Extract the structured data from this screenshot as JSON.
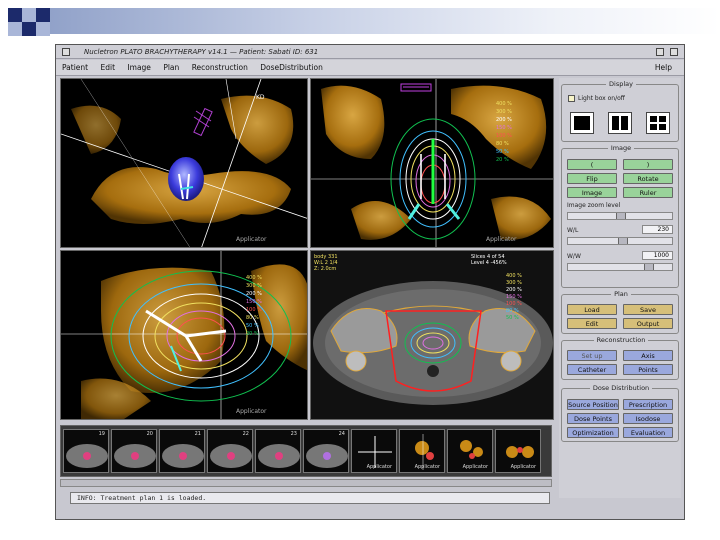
{
  "window": {
    "title": "Nucletron PLATO BRACHYTHERAPY v14.1 — Patient: Sabati  ID: 631",
    "menu": [
      "Patient",
      "Edit",
      "Image",
      "Plan",
      "Reconstruction",
      "DoseDistribution"
    ],
    "help": "Help"
  },
  "views": {
    "top_left": {
      "label": "Applicator",
      "corner": "KD"
    },
    "top_right": {
      "label": "Applicator",
      "isodose_labels": [
        "400 %",
        "300 %",
        "200 %",
        "150 %",
        "100 %",
        "80 %",
        "50 %",
        "20 %"
      ]
    },
    "bottom_left": {
      "label": "Applicator",
      "isodose_labels": [
        "400 %",
        "300 %",
        "200 %",
        "150 %",
        "100 %",
        "80 %",
        "50 %",
        "20 %"
      ]
    },
    "bottom_right": {
      "info_left": [
        "body 331",
        "W:L 2 1/4",
        "Z: 2.0cm"
      ],
      "info_right": [
        "Slices 4 of 54",
        "Level 4 -456%"
      ],
      "isodose_labels": [
        "400 %",
        "300 %",
        "200 %",
        "150 %",
        "100 %",
        "80 %",
        "50 %"
      ]
    }
  },
  "thumbnails": [
    {
      "num": "19"
    },
    {
      "num": "20"
    },
    {
      "num": "21"
    },
    {
      "num": "22"
    },
    {
      "num": "23"
    },
    {
      "num": "24"
    },
    {
      "num": "Applicator"
    },
    {
      "num": "Applicator"
    },
    {
      "num": "Applicator"
    },
    {
      "num": "Applicator"
    }
  ],
  "status_text": "INFO: Treatment plan 1 is loaded.",
  "panel": {
    "display": {
      "title": "Display",
      "checkbox_label": "Light box on/off"
    },
    "image": {
      "title": "Image",
      "prev": "(",
      "next": ")",
      "flip": "Flip",
      "rotate": "Rotate",
      "image_btn": "Image",
      "ruler": "Ruler",
      "zoom_label": "Image zoom level",
      "wl_label": "W/L",
      "wl_value": "230",
      "ww_label": "W/W",
      "ww_value": "1000"
    },
    "plan": {
      "title": "Plan",
      "load": "Load",
      "save": "Save",
      "edit": "Edit",
      "output": "Output"
    },
    "reconstruction": {
      "title": "Reconstruction",
      "set_up": "Set up",
      "axis": "Axis",
      "catheter": "Catheter",
      "points": "Points"
    },
    "dose": {
      "title": "Dose Distribution",
      "source_position": "Source Position",
      "prescription": "Prescription",
      "dose_points": "Dose Points",
      "isodose": "Isodose",
      "optimization": "Optimization",
      "evaluation": "Evaluation"
    }
  },
  "colors": {
    "bone": "#c98a16",
    "bone_light": "#e0a83a",
    "button_green": "#99d39a",
    "button_tan": "#d6bf79",
    "button_blue": "#9aa8dd",
    "deco_dark": "#1c2a6b",
    "deco_light": "#a9b6d8"
  }
}
